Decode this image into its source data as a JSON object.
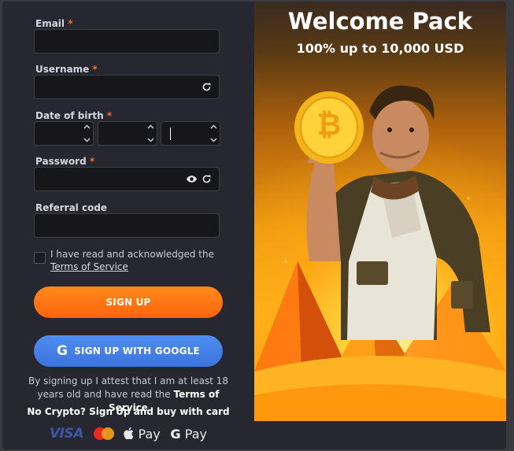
{
  "form": {
    "email_label": "Email",
    "username_label": "Username",
    "dob_label": "Date of birth",
    "password_label": "Password",
    "referral_label": "Referral code",
    "required_mark": "*",
    "agree_text": "I have read and acknowledged the",
    "terms_link": "Terms of Service",
    "signup_button": "SIGN UP",
    "google_button": "SIGN UP WITH GOOGLE",
    "legal_text": "By signing up I attest that I am at least 18 years old and have read the",
    "legal_terms": "Terms of Service",
    "nocrypto_text": "No Crypto? Sign Up and buy with card"
  },
  "payments": {
    "visa": "VISA",
    "apple_pay": "Pay",
    "google_pay": "Pay",
    "google_g": "G"
  },
  "promo": {
    "title": "Welcome Pack",
    "subtitle": "100% up to 10,000 USD",
    "coin_symbol": "₿"
  },
  "icons": {
    "refresh": "refresh-icon",
    "eye": "eye-icon",
    "google": "google-icon"
  },
  "colors": {
    "accent_orange": "#ff7415",
    "google_blue": "#4584ec",
    "modal_bg": "#27272f"
  }
}
